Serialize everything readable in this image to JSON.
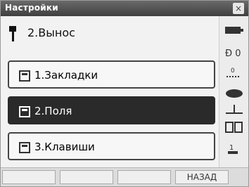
{
  "window": {
    "title": "Настройки"
  },
  "breadcrumb": {
    "label": "2.Вынос"
  },
  "menu": {
    "items": [
      {
        "label": "1.Закладки",
        "selected": false
      },
      {
        "label": "2.Поля",
        "selected": true
      },
      {
        "label": "3.Клавиши",
        "selected": false
      }
    ]
  },
  "status_icons": [
    "battery-icon",
    "prism-icon",
    "ppm-icon",
    "laser-icon",
    "level-icon",
    "memory-icon",
    "signal-icon"
  ],
  "bottom_bar": {
    "keys": [
      "",
      "",
      "",
      "НАЗАД"
    ]
  },
  "colors": {
    "titlebar": "#4f4f4f",
    "selected_item": "#2a2a2a"
  }
}
